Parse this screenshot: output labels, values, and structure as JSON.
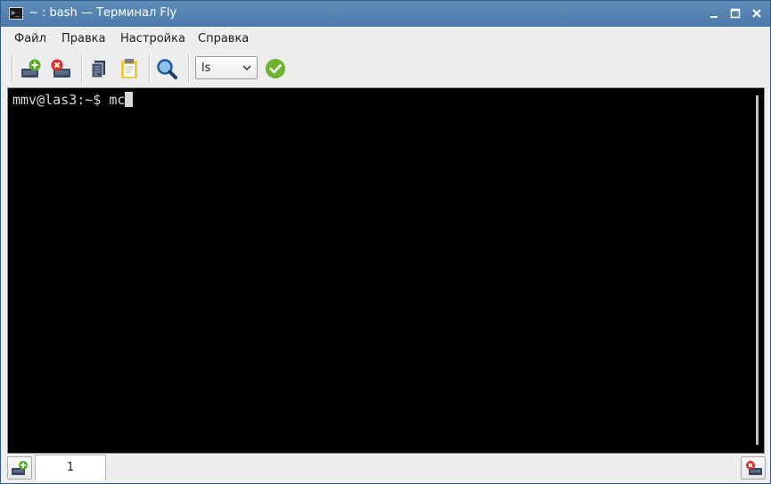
{
  "window": {
    "title": "~ : bash — Терминал Fly",
    "title_icon_glyph": ">_",
    "controls": [
      "minimize-icon",
      "maximize-icon",
      "close-icon"
    ]
  },
  "menu": {
    "items": [
      {
        "label": "Файл"
      },
      {
        "label": "Правка"
      },
      {
        "label": "Настройка"
      },
      {
        "label": "Справка"
      }
    ]
  },
  "toolbar": {
    "icons": [
      "new-session-icon",
      "close-session-icon",
      "copy-icon",
      "paste-icon",
      "search-icon",
      "run-check-icon"
    ],
    "command_combo_value": "ls"
  },
  "terminal": {
    "prompt": "mmv@las3:~$ ",
    "command": "mc"
  },
  "tabs": {
    "items": [
      {
        "label": "1"
      }
    ]
  },
  "colors": {
    "titlebar": "#4a79a9",
    "terminal_bg": "#000000",
    "terminal_fg": "#d9d9d9",
    "accent_green": "#6fb32f",
    "accent_red": "#d9302b"
  }
}
